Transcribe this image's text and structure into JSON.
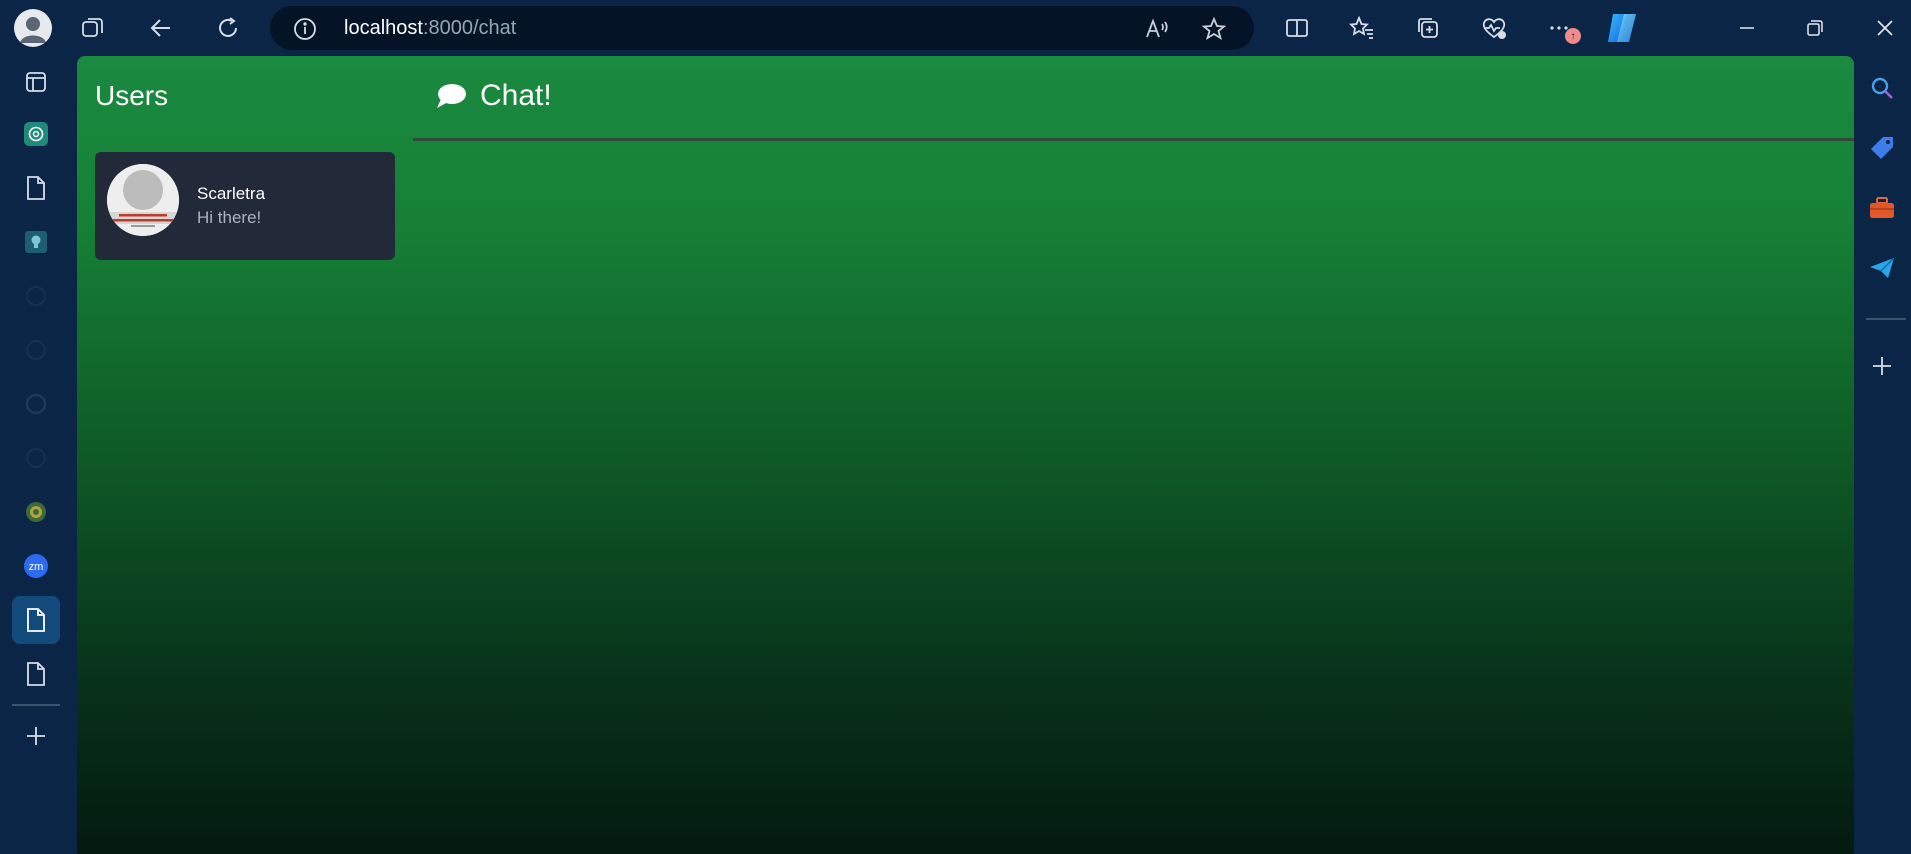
{
  "browser": {
    "address": {
      "host": "localhost",
      "path": ":8000/chat"
    },
    "notification_badge": "↑"
  },
  "page": {
    "users_title": "Users",
    "chat_title": "Chat!",
    "users": [
      {
        "name": "Scarletra",
        "last_message": "Hi there!"
      }
    ]
  },
  "left_sidebar": {
    "items": [
      "tabs-icon",
      "chatgpt-icon",
      "document-icon",
      "lightbulb-icon",
      "github-icon",
      "github-icon",
      "github-icon",
      "github-icon",
      "emblem-icon",
      "zoom-icon",
      "document-icon",
      "document-icon",
      "add-icon"
    ],
    "zoom_label": "zm"
  },
  "colors": {
    "chrome": "#0b2546",
    "address_bg": "#041426",
    "page_top": "#1a8a40",
    "page_bottom": "#031a0f",
    "card": "#222a3a",
    "active_sidebar": "#134a7c"
  }
}
